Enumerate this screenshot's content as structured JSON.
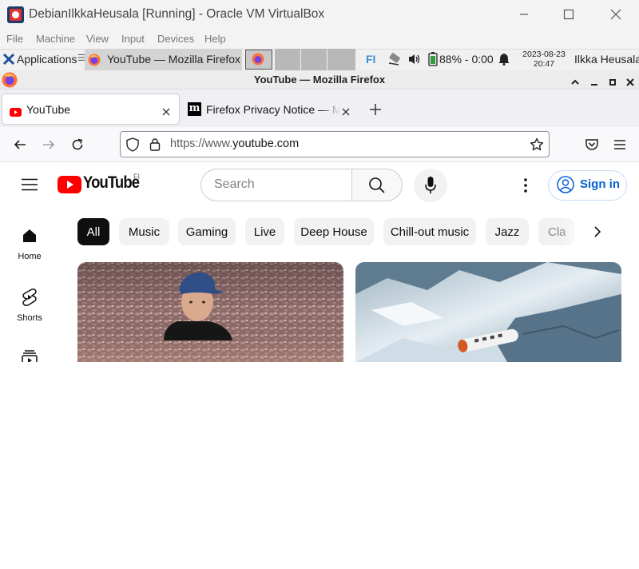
{
  "vbox": {
    "title": "DebianIlkkaHeusala [Running] - Oracle VM VirtualBox",
    "menu": [
      "File",
      "Machine",
      "View",
      "Input",
      "Devices",
      "Help"
    ]
  },
  "panel": {
    "applications": "Applications",
    "separator": "☰",
    "task_title": "YouTube — Mozilla Firefox",
    "keyboard": "FI",
    "battery": "88% - 0:00",
    "date": "2023-08-23",
    "time": "20:47",
    "user": "Ilkka Heusala"
  },
  "firefox": {
    "window_title": "YouTube — Mozilla Firefox",
    "tabs": [
      {
        "title": "YouTube"
      },
      {
        "title": "Firefox Privacy Notice — M"
      }
    ],
    "url_prefix": "https://www.",
    "url_domain": "youtube.com"
  },
  "youtube": {
    "logo_text": "YouTube",
    "country": "FI",
    "search_placeholder": "Search",
    "sign_in": "Sign in",
    "chips": [
      "All",
      "Music",
      "Gaming",
      "Live",
      "Deep House",
      "Chill-out music",
      "Jazz",
      "Cla"
    ],
    "sidebar": [
      "Home",
      "Shorts"
    ]
  },
  "colors": {
    "youtube_red": "#ff0000",
    "link_blue": "#065fd4",
    "firefox_orange": "#ff7139"
  }
}
